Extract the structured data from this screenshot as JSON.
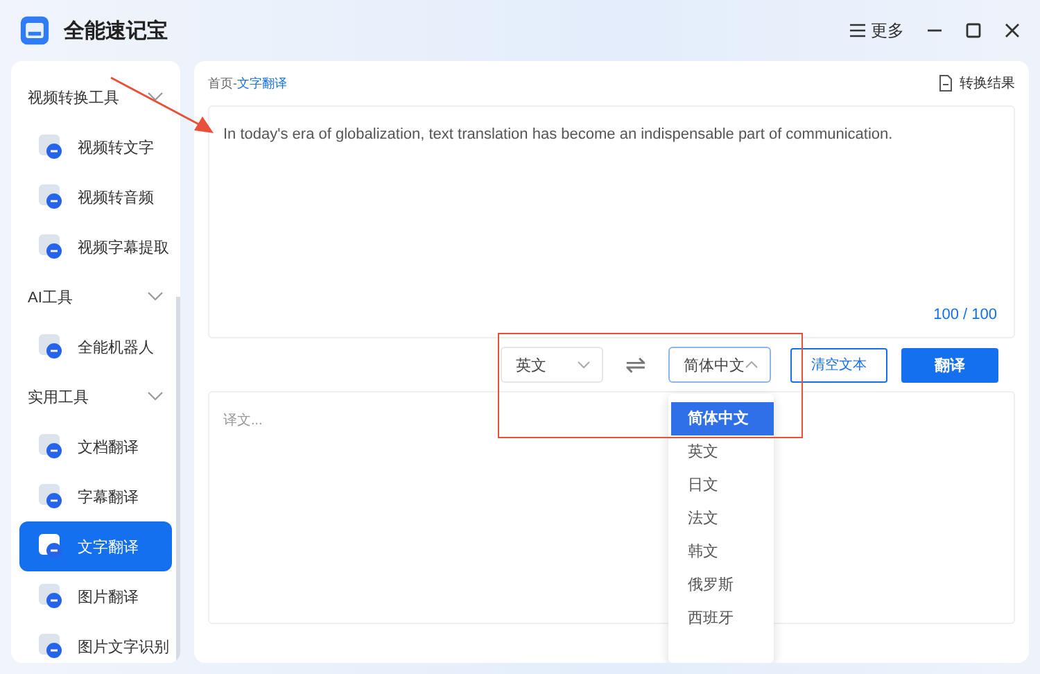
{
  "app": {
    "title": "全能速记宝"
  },
  "title_bar": {
    "more_label": "更多"
  },
  "sidebar": {
    "groups": [
      {
        "label": "视频转换工具",
        "expanded": true,
        "items": [
          {
            "label": "视频转文字",
            "selected": false
          },
          {
            "label": "视频转音频",
            "selected": false
          },
          {
            "label": "视频字幕提取",
            "selected": false
          }
        ]
      },
      {
        "label": "AI工具",
        "expanded": true,
        "items": [
          {
            "label": "全能机器人",
            "selected": false
          }
        ]
      },
      {
        "label": "实用工具",
        "expanded": true,
        "items": [
          {
            "label": "文档翻译",
            "selected": false
          },
          {
            "label": "字幕翻译",
            "selected": false
          },
          {
            "label": "文字翻译",
            "selected": true
          },
          {
            "label": "图片翻译",
            "selected": false
          },
          {
            "label": "图片文字识别",
            "selected": false
          }
        ]
      }
    ]
  },
  "breadcrumb": [
    "首页",
    "-",
    "文字翻译"
  ],
  "results_link": "转换结果",
  "source_text": {
    "value": "In today's era of globalization, text translation has become an indispensable part of communication.",
    "counter": "100 / 100"
  },
  "source_language": {
    "value": "英文",
    "open": false
  },
  "swap_icon": "⇌",
  "target_language": {
    "value": "简体中文",
    "open": true,
    "options": [
      {
        "label": "简体中文",
        "selected": true
      },
      {
        "label": "英文",
        "selected": false
      },
      {
        "label": "日文",
        "selected": false
      },
      {
        "label": "法文",
        "selected": false
      },
      {
        "label": "韩文",
        "selected": false
      },
      {
        "label": "俄罗斯",
        "selected": false
      },
      {
        "label": "西班牙",
        "selected": false
      }
    ]
  },
  "buttons": {
    "clear": "清空文本",
    "translate": "翻译"
  },
  "result_text": {
    "placeholder": "译文..."
  }
}
